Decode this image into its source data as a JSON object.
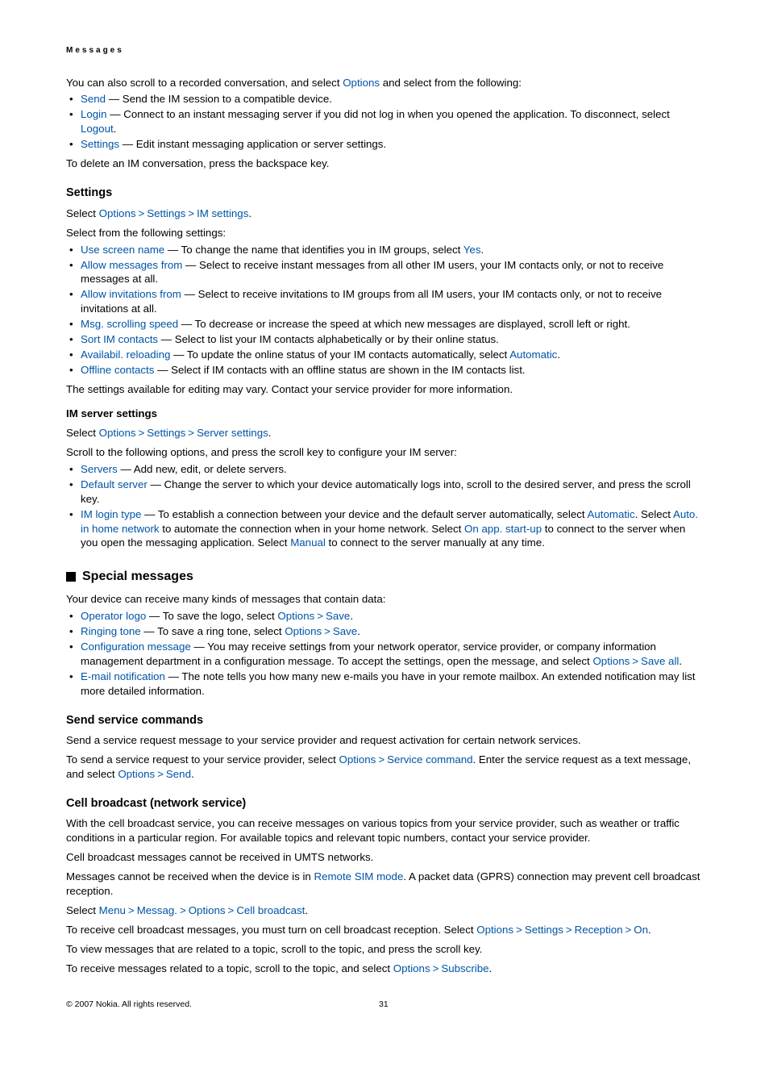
{
  "header": "Messages",
  "intro_para_pre": "You can also scroll to a recorded conversation, and select ",
  "intro_para_link": "Options",
  "intro_para_post": " and select from the following:",
  "top_list": {
    "send_label": "Send",
    "send_text": " — Send the IM session to a compatible device.",
    "login_label": "Login",
    "login_text": " — Connect to an instant messaging server if you did not log in when you opened the application. To disconnect, select ",
    "logout_label": "Logout",
    "settings_label": "Settings",
    "settings_text": " — Edit instant messaging application or server settings."
  },
  "delete_para": "To delete an IM conversation, press the backspace key.",
  "settings_heading": "Settings",
  "settings_select_pre": "Select ",
  "settings_path": {
    "a": "Options",
    "b": "Settings",
    "c": "IM settings"
  },
  "settings_select_post": ".",
  "settings_from": "Select from the following settings:",
  "settings_list": {
    "use_screen_name_label": "Use screen name",
    "use_screen_name_text": " — To change the name that identifies you in IM groups, select ",
    "yes_label": "Yes",
    "allow_messages_label": "Allow messages from",
    "allow_messages_text": " — Select to receive instant messages from all other IM users, your IM contacts only, or not to receive messages at all.",
    "allow_inv_label": "Allow invitations from",
    "allow_inv_text": " — Select to receive invitations to IM groups from all IM users, your IM contacts only, or not to receive invitations at all.",
    "msg_speed_label": "Msg. scrolling speed",
    "msg_speed_text": " — To decrease or increase the speed at which new messages are displayed, scroll left or right.",
    "sort_label": "Sort IM contacts",
    "sort_text": " — Select to list your IM contacts alphabetically or by their online status.",
    "avail_label": "Availabil. reloading",
    "avail_text": " — To update the online status of your IM contacts automatically, select ",
    "automatic_label": "Automatic",
    "offline_label": "Offline contacts",
    "offline_text": " — Select if IM contacts with an offline status are shown in the IM contacts list."
  },
  "settings_vary": "The settings available for editing may vary. Contact your service provider for more information.",
  "im_server_heading": "IM server settings",
  "im_server_select_pre": "Select ",
  "im_server_path": {
    "a": "Options",
    "b": "Settings",
    "c": "Server settings"
  },
  "im_server_select_post": ".",
  "im_server_scroll": "Scroll to the following options, and press the scroll key to configure your IM server:",
  "server_list": {
    "servers_label": "Servers",
    "servers_text": " — Add new, edit, or delete servers.",
    "default_label": "Default server",
    "default_text": " — Change the server to which your device automatically logs into, scroll to the desired server, and press the scroll key.",
    "login_type_label": "IM login type",
    "login_type_t1": " — To establish a connection between your device and the default server automatically, select ",
    "automatic_label": "Automatic",
    "login_type_t2": ". Select ",
    "auto_home_label": "Auto. in home network",
    "login_type_t3": " to automate the connection when in your home network. Select ",
    "on_app_label": "On app. start-up",
    "login_type_t4": " to connect to the server when you open the messaging application. Select ",
    "manual_label": "Manual",
    "login_type_t5": " to connect to the server manually at any time."
  },
  "special_heading": "Special messages",
  "special_intro": "Your device can receive many kinds of messages that contain data:",
  "special_list": {
    "operator_label": "Operator logo",
    "operator_t1": " — To save the logo, select ",
    "options_label": "Options",
    "save_label": "Save",
    "ringing_label": "Ringing tone",
    "ringing_t1": " — To save a ring tone, select ",
    "config_label": "Configuration message",
    "config_t1": " — You may receive settings from your network operator, service provider, or company information management department in a configuration message. To accept the settings, open the message, and select ",
    "save_all_label": "Save all",
    "email_label": "E-mail notification",
    "email_text": " — The note tells you how many new e-mails you have in your remote mailbox. An extended notification may list more detailed information."
  },
  "send_cmd_heading": "Send service commands",
  "send_cmd_para": "Send a service request message to your service provider and request activation for certain network services.",
  "send_cmd_p2_t1": "To send a service request to your service provider, select ",
  "send_cmd_options": "Options",
  "send_cmd_service": "Service command",
  "send_cmd_p2_t2": ". Enter the service request as a text message, and select ",
  "send_cmd_send": "Send",
  "send_cmd_p2_t3": ".",
  "cell_heading": "Cell broadcast (network service)",
  "cell_p1": "With the cell broadcast service, you can receive messages on various topics from your service provider, such as weather or traffic conditions in a particular region. For available topics and relevant topic numbers, contact your service provider.",
  "cell_p2": "Cell broadcast messages cannot be received in UMTS networks.",
  "cell_p3_t1": "Messages cannot be received when the device is in ",
  "cell_remote": "Remote SIM mode",
  "cell_p3_t2": ". A packet data (GPRS) connection may prevent cell broadcast reception.",
  "cell_p4_t1": "Select ",
  "cell_menu": "Menu",
  "cell_messag": "Messag.",
  "cell_options": "Options",
  "cell_cb": "Cell broadcast",
  "cell_p5_t1": "To receive cell broadcast messages, you must turn on cell broadcast reception. Select ",
  "cell_settings": "Settings",
  "cell_reception": "Reception",
  "cell_on": "On",
  "cell_p6": "To view messages that are related to a topic, scroll to the topic, and press the scroll key.",
  "cell_p7_t1": "To receive messages related to a topic, scroll to the topic, and select ",
  "cell_subscribe": "Subscribe",
  "footer": {
    "copyright": "© 2007 Nokia. All rights reserved.",
    "page": "31"
  },
  "sep": ">"
}
